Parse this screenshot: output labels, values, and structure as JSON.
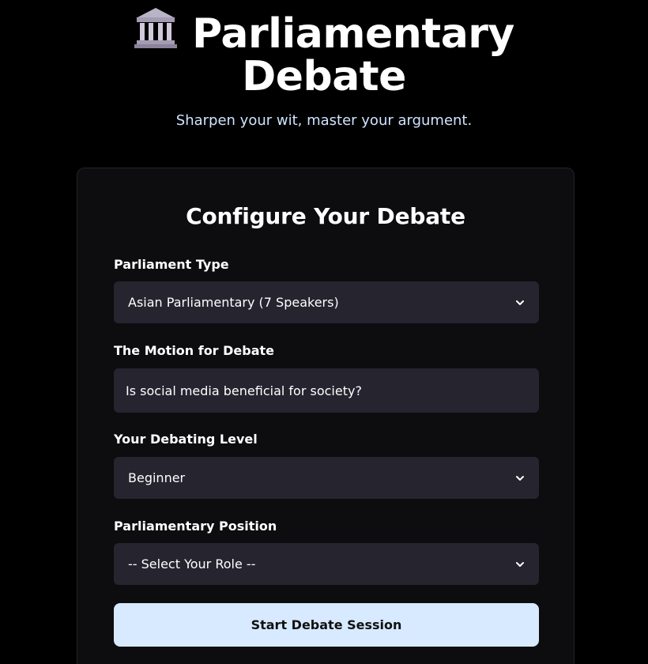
{
  "header": {
    "icon": "classical-building-icon",
    "title_line1": "Parliamentary",
    "title_line2": "Debate",
    "subtitle": "Sharpen your wit, master your argument."
  },
  "form": {
    "heading": "Configure Your Debate",
    "parliament_type": {
      "label": "Parliament Type",
      "value": "Asian Parliamentary (7 Speakers)"
    },
    "motion": {
      "label": "The Motion for Debate",
      "value": "Is social media beneficial for society?"
    },
    "level": {
      "label": "Your Debating Level",
      "value": "Beginner"
    },
    "position": {
      "label": "Parliamentary Position",
      "value": "-- Select Your Role --"
    },
    "submit_label": "Start Debate Session"
  },
  "colors": {
    "background": "#000000",
    "card": "#0d0d0f",
    "control": "#25242f",
    "button": "#d7eaff",
    "subtitle": "#cfe4ff"
  }
}
